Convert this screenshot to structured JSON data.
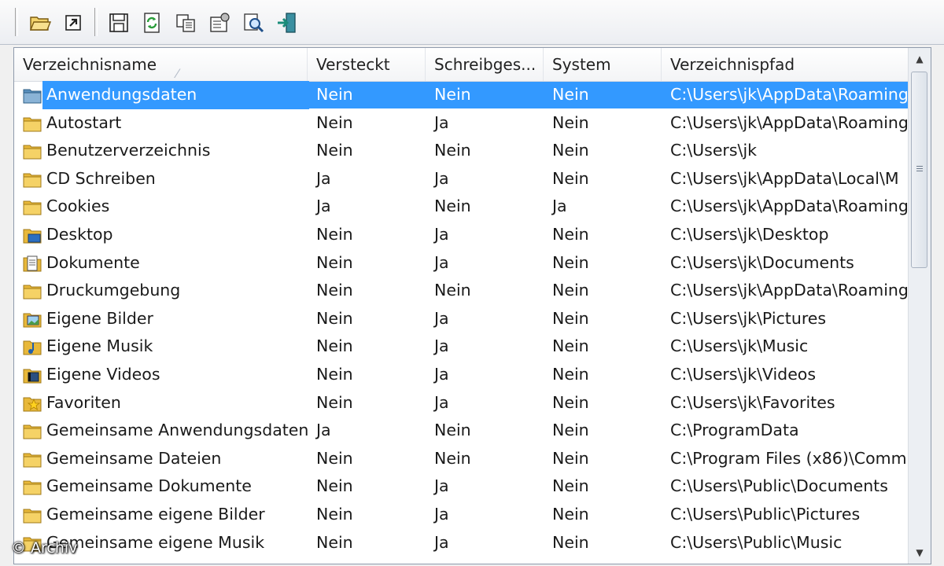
{
  "toolbar": {
    "buttons": [
      {
        "name": "open-folder"
      },
      {
        "name": "shortcut"
      },
      {
        "name": "save"
      },
      {
        "name": "refresh"
      },
      {
        "name": "copy"
      },
      {
        "name": "properties"
      },
      {
        "name": "search"
      },
      {
        "name": "exit"
      }
    ]
  },
  "list": {
    "columns": [
      "Verzeichnisname",
      "Versteckt",
      "Schreibges...",
      "System",
      "Verzeichnispfad"
    ],
    "rows": [
      {
        "name": "Anwendungsdaten",
        "hidden": "Nein",
        "readonly": "Nein",
        "system": "Nein",
        "path": "C:\\Users\\jk\\AppData\\Roaming",
        "icon": "folder-special-icon"
      },
      {
        "name": "Autostart",
        "hidden": "Nein",
        "readonly": "Ja",
        "system": "Nein",
        "path": "C:\\Users\\jk\\AppData\\Roaming",
        "icon": "folder-icon"
      },
      {
        "name": "Benutzerverzeichnis",
        "hidden": "Nein",
        "readonly": "Nein",
        "system": "Nein",
        "path": "C:\\Users\\jk",
        "icon": "folder-icon"
      },
      {
        "name": "CD Schreiben",
        "hidden": "Ja",
        "readonly": "Ja",
        "system": "Nein",
        "path": "C:\\Users\\jk\\AppData\\Local\\M",
        "icon": "folder-icon"
      },
      {
        "name": "Cookies",
        "hidden": "Ja",
        "readonly": "Nein",
        "system": "Ja",
        "path": "C:\\Users\\jk\\AppData\\Roaming",
        "icon": "folder-icon"
      },
      {
        "name": "Desktop",
        "hidden": "Nein",
        "readonly": "Ja",
        "system": "Nein",
        "path": "C:\\Users\\jk\\Desktop",
        "icon": "desktop-folder-icon"
      },
      {
        "name": "Dokumente",
        "hidden": "Nein",
        "readonly": "Ja",
        "system": "Nein",
        "path": "C:\\Users\\jk\\Documents",
        "icon": "documents-folder-icon"
      },
      {
        "name": "Druckumgebung",
        "hidden": "Nein",
        "readonly": "Nein",
        "system": "Nein",
        "path": "C:\\Users\\jk\\AppData\\Roaming",
        "icon": "folder-icon"
      },
      {
        "name": "Eigene Bilder",
        "hidden": "Nein",
        "readonly": "Ja",
        "system": "Nein",
        "path": "C:\\Users\\jk\\Pictures",
        "icon": "pictures-folder-icon"
      },
      {
        "name": "Eigene Musik",
        "hidden": "Nein",
        "readonly": "Ja",
        "system": "Nein",
        "path": "C:\\Users\\jk\\Music",
        "icon": "music-folder-icon"
      },
      {
        "name": "Eigene Videos",
        "hidden": "Nein",
        "readonly": "Ja",
        "system": "Nein",
        "path": "C:\\Users\\jk\\Videos",
        "icon": "videos-folder-icon"
      },
      {
        "name": "Favoriten",
        "hidden": "Nein",
        "readonly": "Ja",
        "system": "Nein",
        "path": "C:\\Users\\jk\\Favorites",
        "icon": "favorites-folder-icon"
      },
      {
        "name": "Gemeinsame Anwendungsdaten",
        "hidden": "Ja",
        "readonly": "Nein",
        "system": "Nein",
        "path": "C:\\ProgramData",
        "icon": "folder-icon"
      },
      {
        "name": "Gemeinsame Dateien",
        "hidden": "Nein",
        "readonly": "Nein",
        "system": "Nein",
        "path": "C:\\Program Files (x86)\\Comm",
        "icon": "folder-icon"
      },
      {
        "name": "Gemeinsame Dokumente",
        "hidden": "Nein",
        "readonly": "Ja",
        "system": "Nein",
        "path": "C:\\Users\\Public\\Documents",
        "icon": "folder-icon"
      },
      {
        "name": "Gemeinsame eigene Bilder",
        "hidden": "Nein",
        "readonly": "Ja",
        "system": "Nein",
        "path": "C:\\Users\\Public\\Pictures",
        "icon": "folder-icon"
      },
      {
        "name": "Gemeinsame eigene Musik",
        "hidden": "Nein",
        "readonly": "Ja",
        "system": "Nein",
        "path": "C:\\Users\\Public\\Music",
        "icon": "folder-icon"
      }
    ],
    "selected_index": 0
  },
  "watermark": "© Archiv",
  "colors": {
    "selection": "#3399ff",
    "folder": "#e8b83a"
  }
}
